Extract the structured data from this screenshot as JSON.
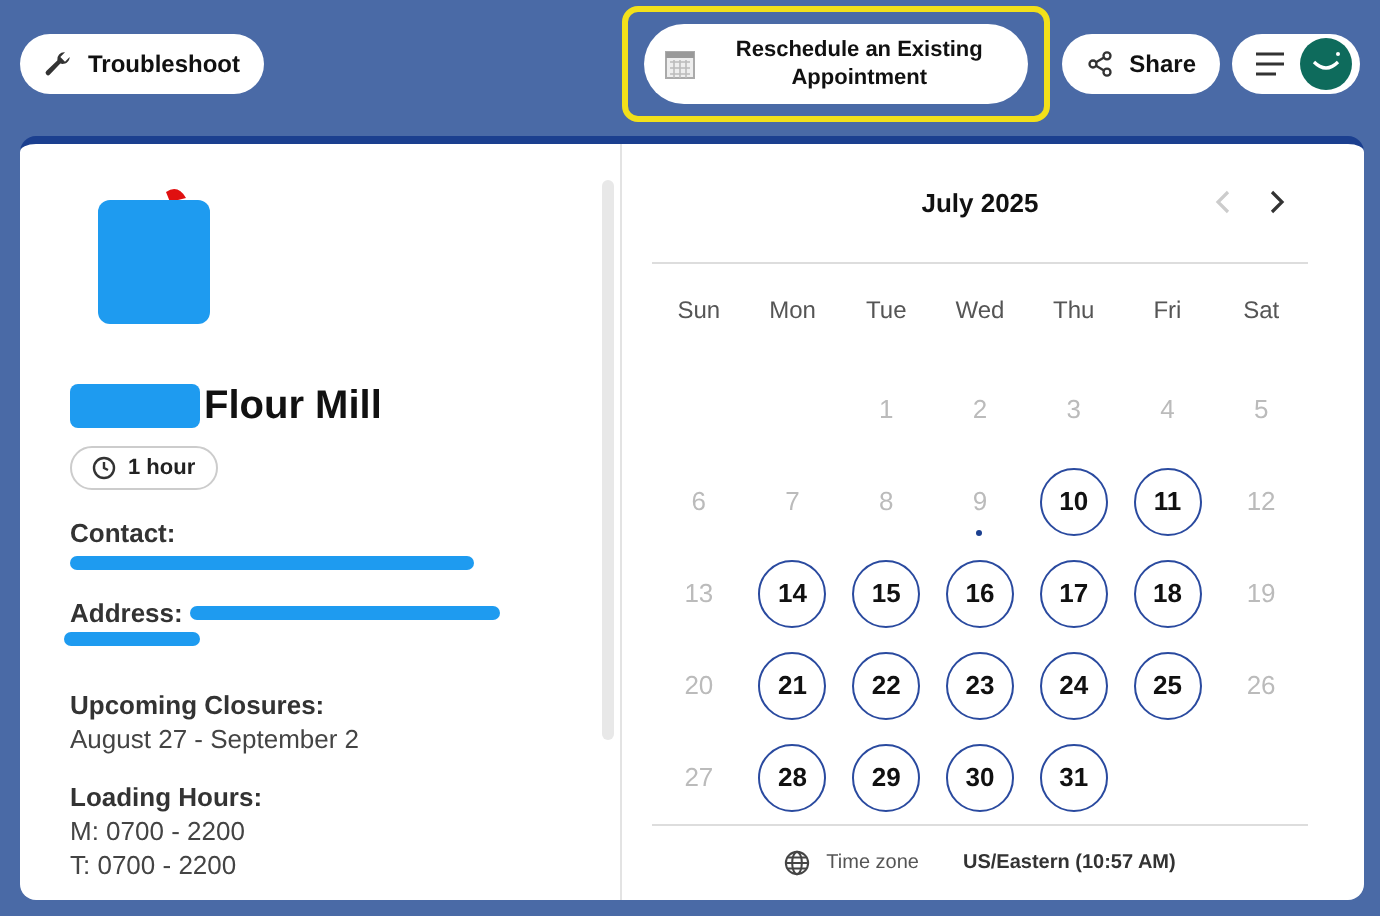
{
  "toolbar": {
    "troubleshoot": "Troubleshoot",
    "reschedule": {
      "label": "Reschedule an Existing Appointment",
      "highlighted": true
    },
    "share": "Share"
  },
  "details": {
    "name": "Flour Mill",
    "duration": "1 hour",
    "contact_label": "Contact:",
    "address_label": "Address:",
    "closures_label": "Upcoming Closures:",
    "closures": "August 27 - September 2",
    "hours_label": "Loading Hours:",
    "hours": [
      "M: 0700 - 2200",
      "T: 0700 - 2200"
    ]
  },
  "calendar": {
    "month": "July 2025",
    "prev": {
      "disabled": true
    },
    "next": {
      "disabled": false
    },
    "weekdays": [
      "Sun",
      "Mon",
      "Tue",
      "Wed",
      "Thu",
      "Fri",
      "Sat"
    ],
    "weeks": [
      [
        {
          "kind": "empty"
        },
        {
          "kind": "empty"
        },
        {
          "kind": "day",
          "day": "1",
          "available": false,
          "today": false
        },
        {
          "kind": "day",
          "day": "2",
          "available": false,
          "today": false
        },
        {
          "kind": "day",
          "day": "3",
          "available": false,
          "today": false
        },
        {
          "kind": "day",
          "day": "4",
          "available": false,
          "today": false
        },
        {
          "kind": "day",
          "day": "5",
          "available": false,
          "today": false
        }
      ],
      [
        {
          "kind": "day",
          "day": "6",
          "available": false,
          "today": false
        },
        {
          "kind": "day",
          "day": "7",
          "available": false,
          "today": false
        },
        {
          "kind": "day",
          "day": "8",
          "available": false,
          "today": false
        },
        {
          "kind": "day",
          "day": "9",
          "available": false,
          "today": true
        },
        {
          "kind": "day",
          "day": "10",
          "available": true,
          "today": false
        },
        {
          "kind": "day",
          "day": "11",
          "available": true,
          "today": false
        },
        {
          "kind": "day",
          "day": "12",
          "available": false,
          "today": false
        }
      ],
      [
        {
          "kind": "day",
          "day": "13",
          "available": false,
          "today": false
        },
        {
          "kind": "day",
          "day": "14",
          "available": true,
          "today": false
        },
        {
          "kind": "day",
          "day": "15",
          "available": true,
          "today": false
        },
        {
          "kind": "day",
          "day": "16",
          "available": true,
          "today": false
        },
        {
          "kind": "day",
          "day": "17",
          "available": true,
          "today": false
        },
        {
          "kind": "day",
          "day": "18",
          "available": true,
          "today": false
        },
        {
          "kind": "day",
          "day": "19",
          "available": false,
          "today": false
        }
      ],
      [
        {
          "kind": "day",
          "day": "20",
          "available": false,
          "today": false
        },
        {
          "kind": "day",
          "day": "21",
          "available": true,
          "today": false
        },
        {
          "kind": "day",
          "day": "22",
          "available": true,
          "today": false
        },
        {
          "kind": "day",
          "day": "23",
          "available": true,
          "today": false
        },
        {
          "kind": "day",
          "day": "24",
          "available": true,
          "today": false
        },
        {
          "kind": "day",
          "day": "25",
          "available": true,
          "today": false
        },
        {
          "kind": "day",
          "day": "26",
          "available": false,
          "today": false
        }
      ],
      [
        {
          "kind": "day",
          "day": "27",
          "available": false,
          "today": false
        },
        {
          "kind": "day",
          "day": "28",
          "available": true,
          "today": false
        },
        {
          "kind": "day",
          "day": "29",
          "available": true,
          "today": false
        },
        {
          "kind": "day",
          "day": "30",
          "available": true,
          "today": false
        },
        {
          "kind": "day",
          "day": "31",
          "available": true,
          "today": false
        },
        {
          "kind": "empty"
        },
        {
          "kind": "empty"
        }
      ]
    ],
    "timezone_label": "Time zone",
    "timezone": "US/Eastern (10:57 AM)"
  }
}
